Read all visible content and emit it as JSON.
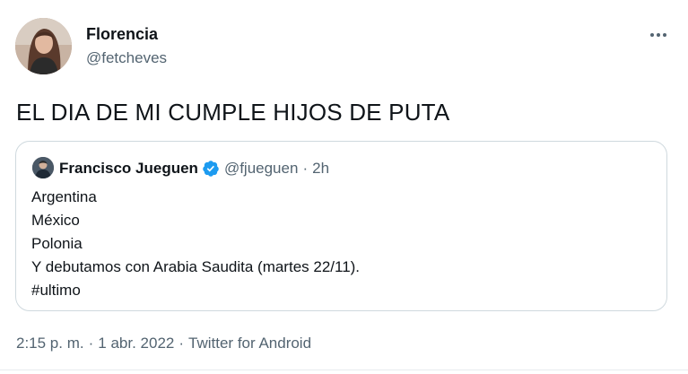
{
  "tweet": {
    "author": {
      "name": "Florencia",
      "handle": "@fetcheves"
    },
    "text": "EL DIA DE MI CUMPLE HIJOS DE PUTA",
    "more_icon": "more-horizontal-icon",
    "quoted": {
      "author_name": "Francisco Jueguen",
      "verified_icon": "verified-badge-icon",
      "handle": "@fjueguen",
      "separator": "·",
      "time": "2h",
      "lines": [
        "Argentina",
        "México",
        "Polonia",
        "Y debutamos con Arabia Saudita (martes 22/11).",
        "#ultimo"
      ]
    },
    "meta": {
      "time": "2:15 p. m.",
      "separator": "·",
      "date": "1 abr. 2022",
      "source": "Twitter for Android"
    }
  },
  "colors": {
    "text_primary": "#0f1419",
    "text_secondary": "#536471",
    "border": "#cfd9de",
    "verified_blue": "#1d9bf0"
  }
}
